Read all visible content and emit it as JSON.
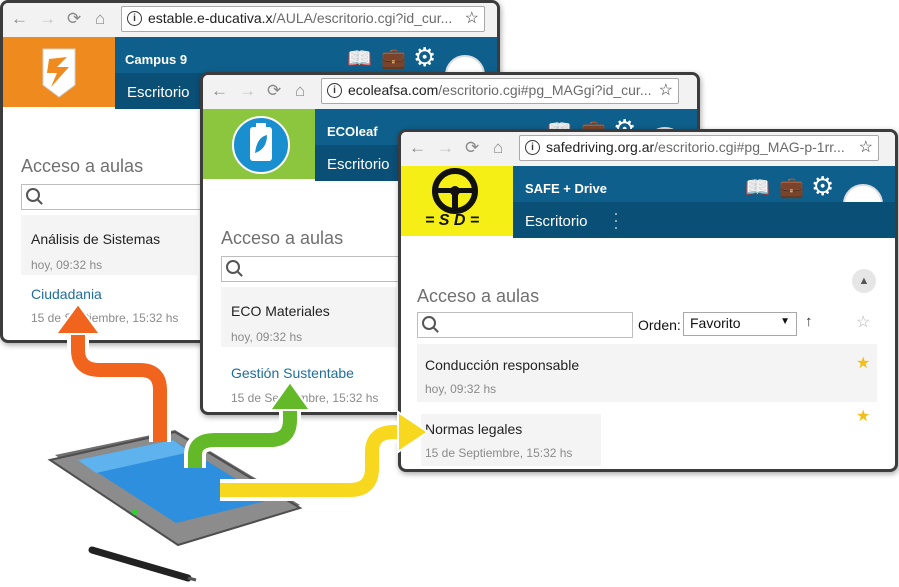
{
  "windows": {
    "w1": {
      "url_domain": "estable.e-ducativa.x",
      "url_path": "/AULA/escritorio.cgi?id_cur...",
      "campus_name": "Campus 9",
      "nav_label": "Escritorio",
      "section_title": "Acceso a aulas",
      "card1_title": "Análisis de Sistemas",
      "card1_time": "hoy, 09:32 hs",
      "card2_link": "Ciudadania",
      "card2_time": "15 de Septiembre, 15:32 hs"
    },
    "w2": {
      "url_domain": "ecoleafsa.com",
      "url_path": "/escritorio.cgi#pg_MAGgi?id_cur...",
      "campus_name": "ECOleaf",
      "nav_label": "Escritorio",
      "section_title": "Acceso a aulas",
      "card1_title": "ECO Materiales",
      "card1_time": "hoy, 09:32 hs",
      "card2_link": "Gestión Sustentabe",
      "card2_time": "15 de Septiembre, 15:32 hs"
    },
    "w3": {
      "url_domain": "safedriving.org.ar",
      "url_path": "/escritorio.cgi#pg_MAG-p-1rr...",
      "campus_name": "SAFE + Drive",
      "nav_label": "Escritorio",
      "logo_text": "= S D =",
      "section_title": "Acceso a aulas",
      "order_label": "Orden:",
      "order_value": "Favorito",
      "card1_title": "Conducción responsable",
      "card1_time": "hoy, 09:32 hs",
      "card2_title": "Normas legales",
      "card2_time": "15 de Septiembre, 15:32 hs"
    }
  },
  "colors": {
    "header_blue": "#0e5f8b",
    "orange_logo": "#ef8a1e",
    "green_logo": "#8cc63f",
    "yellow_logo": "#f5ef15",
    "arrow_orange": "#f0641e",
    "arrow_green": "#64b928",
    "arrow_yellow": "#f8d81e"
  }
}
